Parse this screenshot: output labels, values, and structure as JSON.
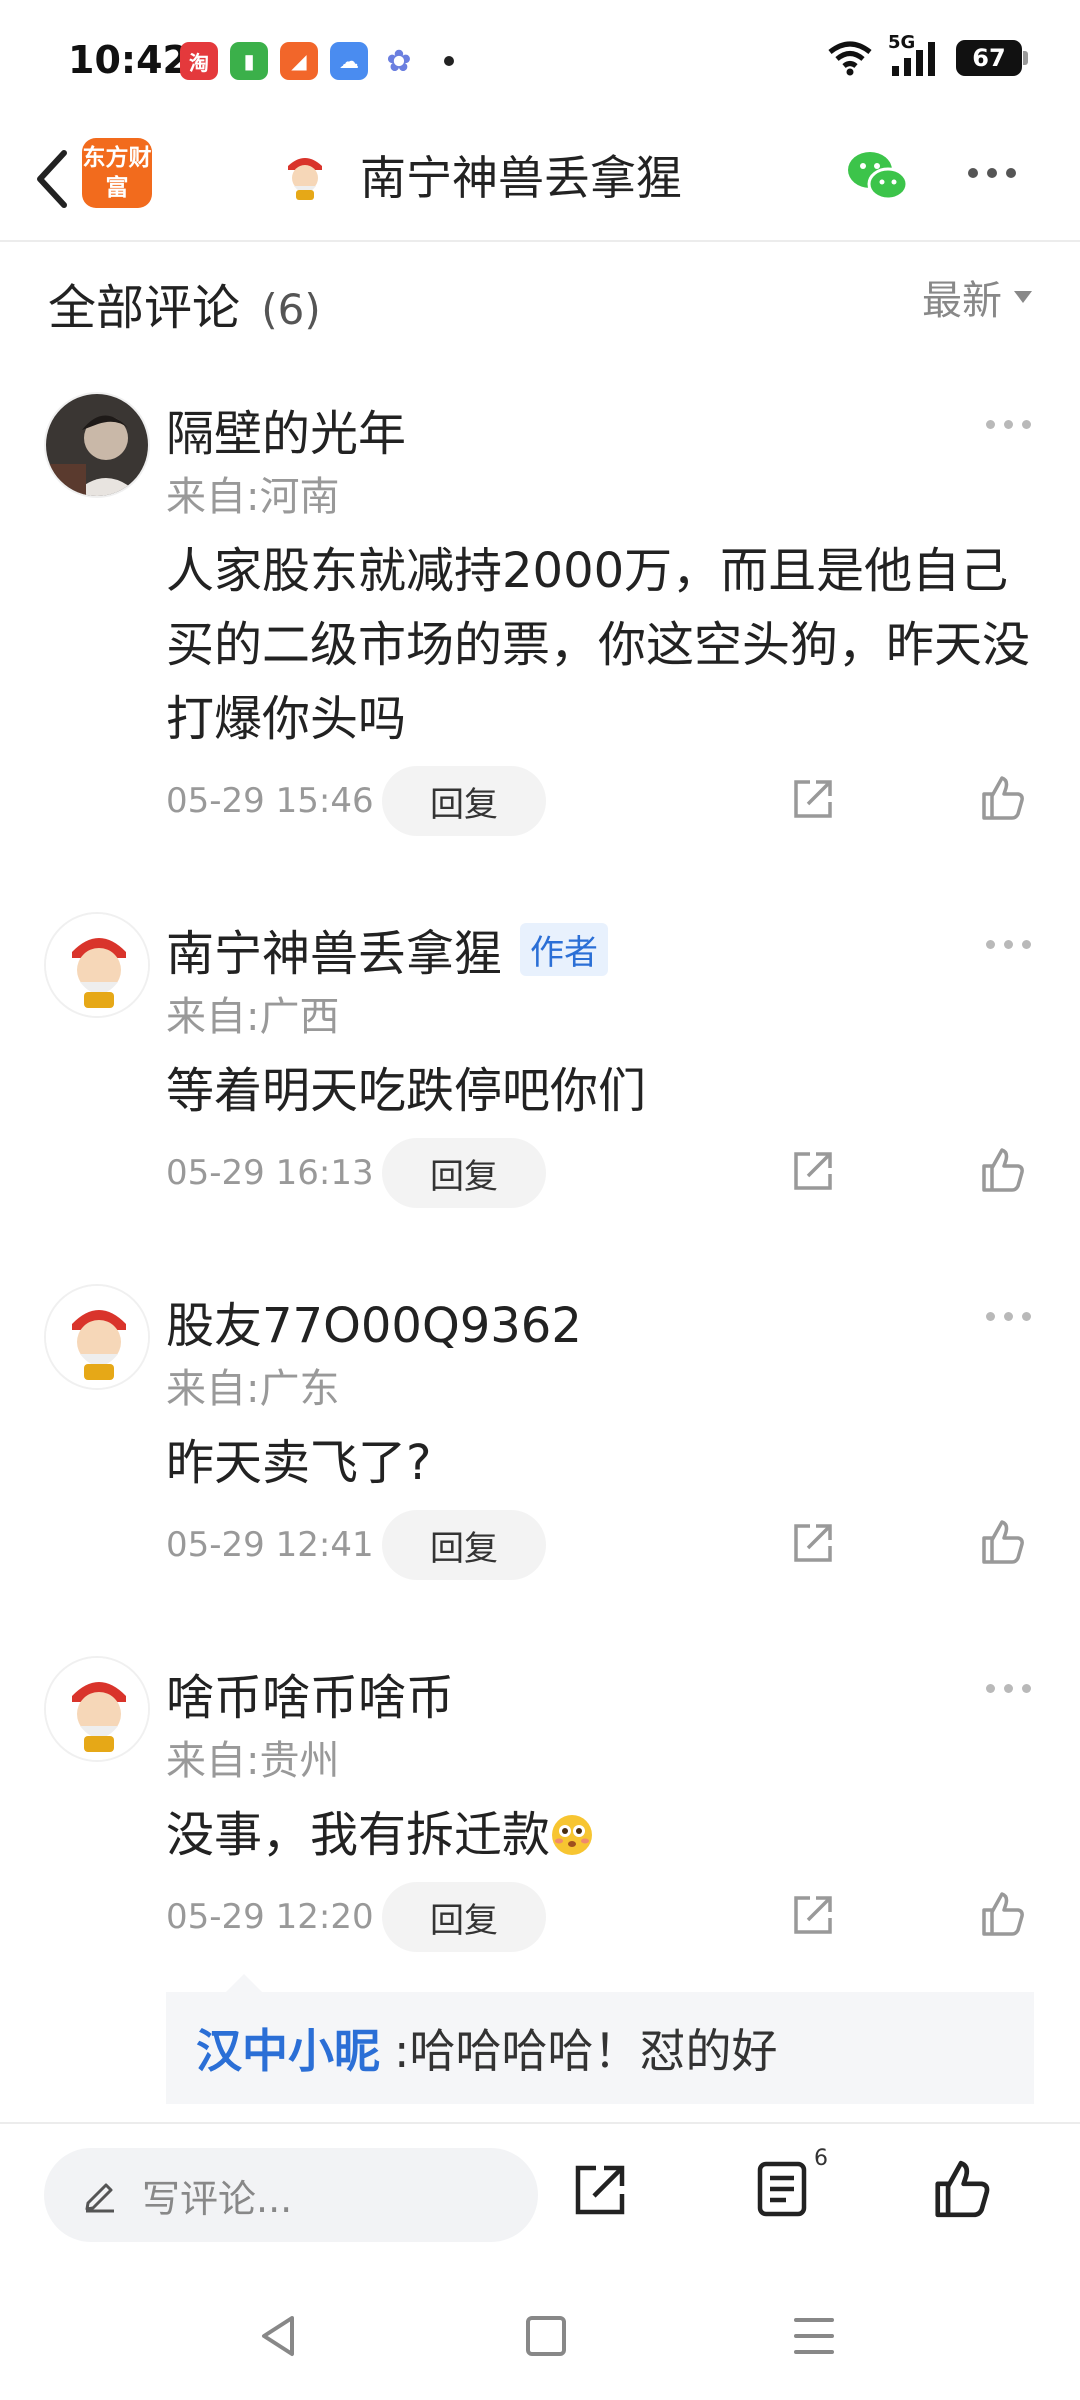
{
  "status_bar": {
    "time": "10:42",
    "network": "5G",
    "battery": "67",
    "app_icons": [
      "taobao-icon",
      "green-app-icon",
      "orange-app-icon",
      "weather-icon",
      "cloud-app-icon"
    ]
  },
  "header": {
    "logo_text": "东方财富",
    "title": "南宁神兽丢拿猩"
  },
  "comments_section": {
    "title": "全部评论",
    "count": "(6)",
    "sort_label": "最新"
  },
  "comments": [
    {
      "name": "隔壁的光年",
      "location": "来自:河南",
      "text": "人家股东就减持2000万，而且是他自己买的二级市场的票，你这空头狗，昨天没打爆你头吗",
      "time": "05-29 15:46",
      "reply_label": "回复"
    },
    {
      "name": "南宁神兽丢拿猩",
      "author_tag": "作者",
      "location": "来自:广西",
      "text": "等着明天吃跌停吧你们",
      "time": "05-29 16:13",
      "reply_label": "回复"
    },
    {
      "name": "股友77O00Q9362",
      "location": "来自:广东",
      "text": "昨天卖飞了?",
      "time": "05-29 12:41",
      "reply_label": "回复"
    },
    {
      "name": "啥币啥币啥币",
      "location": "来自:贵州",
      "text": "没事，我有拆迁款",
      "time": "05-29 12:20",
      "reply_label": "回复"
    }
  ],
  "sub_reply": {
    "user": "汉中小昵",
    "text": ":哈哈哈哈！怼的好"
  },
  "bottom_bar": {
    "input_placeholder": "写评论...",
    "comment_count_badge": "6"
  },
  "colors": {
    "brand_orange": "#f26b1d",
    "link_blue": "#2b6fd6",
    "wechat_green": "#3cc44a"
  }
}
